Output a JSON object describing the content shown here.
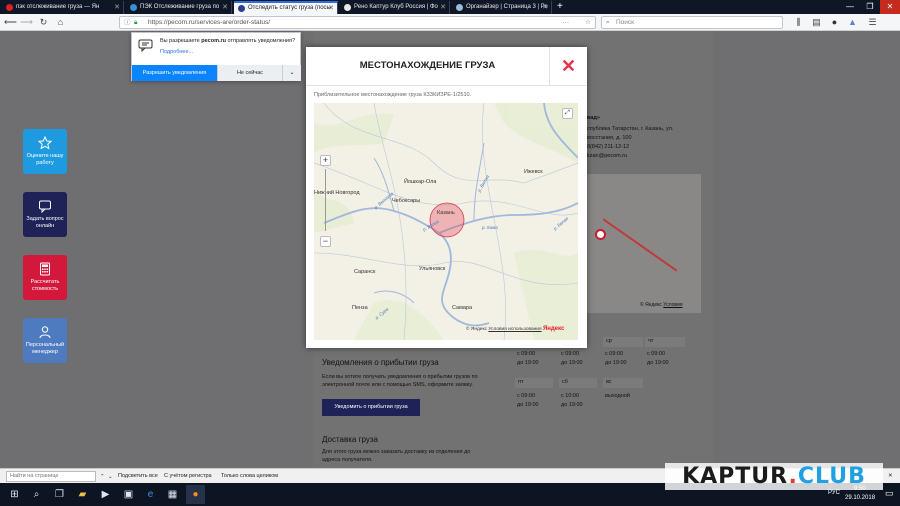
{
  "tabs": [
    {
      "label": "пэк отслеживание груза — Ян"
    },
    {
      "label": "ПЭК Отслеживание груза по"
    },
    {
      "label": "Отследить статус груза (посы"
    },
    {
      "label": "Рено Каптур Клуб Россия | Фо"
    },
    {
      "label": "Органайзер | Страница 3 | Ре"
    }
  ],
  "window_controls": {
    "min": "—",
    "max": "❐",
    "close": "✕"
  },
  "nav": {
    "url": "https://pecom.ru/services-are/order-status/",
    "search_placeholder": "Поиск"
  },
  "notification": {
    "question": "Вы разрешаете",
    "site": "pecom.ru",
    "question_rest": "отправлять уведомления?",
    "more": "Подробнее...",
    "allow": "Разрешить уведомления",
    "not_now": "Не сейчас"
  },
  "sidebar": [
    {
      "label": "Оцените нашу работу",
      "color": "#1e9be0"
    },
    {
      "label": "Задать вопрос онлайн",
      "color": "#1f2257"
    },
    {
      "label": "Рассчитать стоимость",
      "color": "#d3183b"
    },
    {
      "label": "Персональный менеджер",
      "color": "#4e7bc0"
    }
  ],
  "background": {
    "office_line1": "вад»",
    "office_line2": "спублика Татарстан, г. Казань, ул.",
    "office_line3": "восстания, д. 100",
    "office_phone": "8(842) 211-12-12",
    "office_mail": "kzan@pecom.ru",
    "arrival_title": "Уведомления о прибытии груза",
    "arrival_text1": "Если вы хотите получать уведомления о прибытии грузов по",
    "arrival_text2": "электронной почте или с помощью SMS, оформите заявку.",
    "arrival_button": "Уведомить о прибытии груза",
    "delivery_title": "Доставка груза",
    "delivery_text1": "Для этого груза можно заказать доставку из отделения до",
    "delivery_text2": "адреса получателя.",
    "days": [
      "ср",
      "чт",
      "пт",
      "сб",
      "вс"
    ],
    "from1": "с 09:00",
    "to1": "до 19:00",
    "from2": "с 10:00",
    "to2": "до 19:00",
    "dayoff": "выходной",
    "map_attr": "© Яндекс",
    "map_terms": "Условия"
  },
  "modal": {
    "title": "МЕСТОНАХОЖДЕНИЕ ГРУЗА",
    "close": "✕",
    "note": "Приблизительное местонахождение груза КЗЗКИЗРЕ-1/2510.",
    "zoom_in": "+",
    "zoom_out": "−",
    "fullscreen": "⤢",
    "attribution": "© Яндекс",
    "terms": "Условия использования",
    "logo": "Яндекс",
    "cities": [
      "Йошкар-Ола",
      "Ижевск",
      "Нижний Новгород",
      "Чебоксары",
      "Казань",
      "Ульяновск",
      "Саранск",
      "Пенза",
      "Самара"
    ],
    "rivers": [
      "р. Ветлуга",
      "р. Вятка",
      "р. Волга",
      "р. Кама",
      "р. Белая",
      "р. Сура"
    ]
  },
  "findbar": {
    "placeholder": "Найти на странице",
    "highlight_all": "Подсветить все",
    "match_case": "С учётом регистра",
    "whole_words": "Только слова целиком"
  },
  "taskbar": {
    "lang": "РУС",
    "time": "9:50",
    "date": "29.10.2018"
  },
  "watermark": {
    "kaptur": "KAPTUR",
    "dot": ".",
    "club": "CLUB"
  }
}
